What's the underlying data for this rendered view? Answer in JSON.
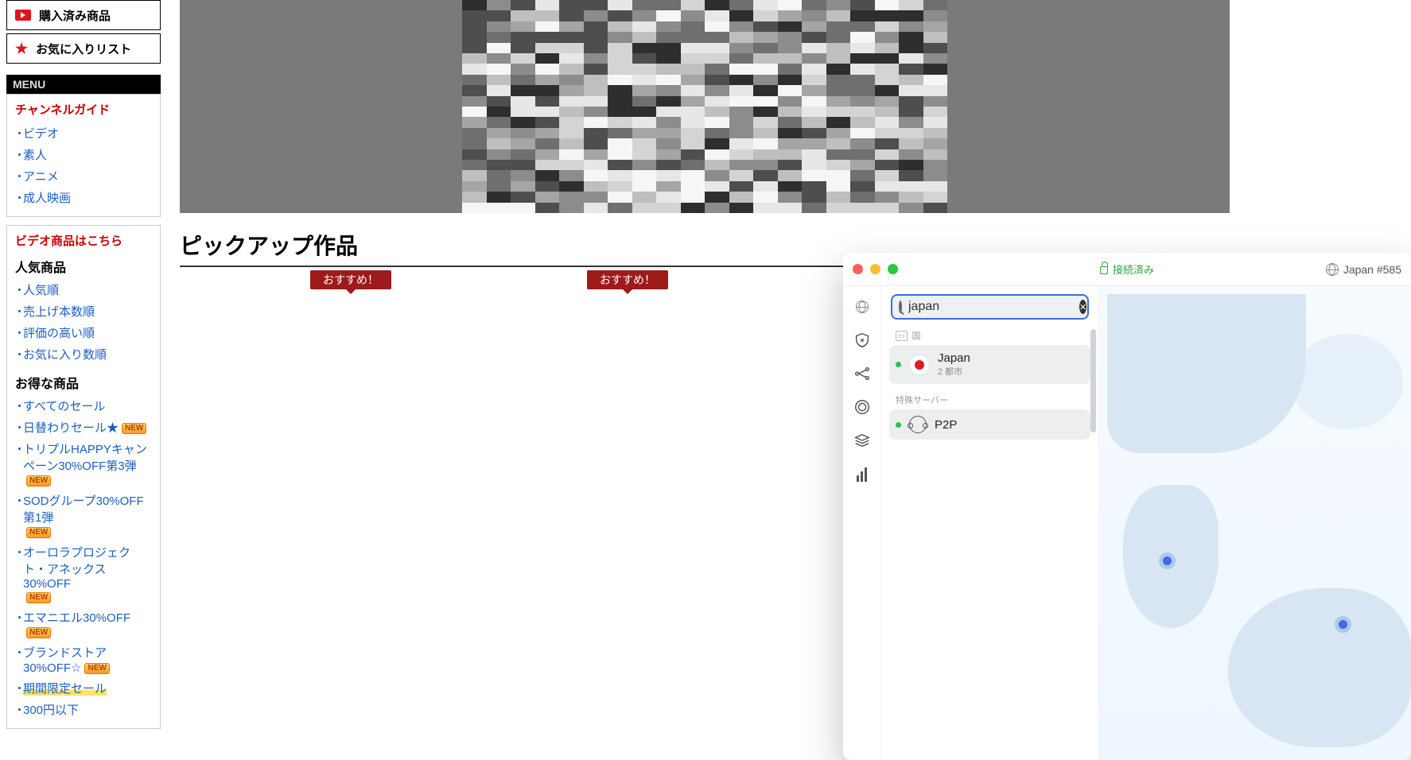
{
  "sidebar": {
    "top_buttons": [
      {
        "label": "購入済み商品"
      },
      {
        "label": "お気に入りリスト"
      }
    ],
    "menu_label": "MENU",
    "channel_guide_header": "チャンネルガイド",
    "channel_links": [
      "ビデオ",
      "素人",
      "アニメ",
      "成人映画"
    ],
    "video_products_header": "ビデオ商品はこちら",
    "popular_header": "人気商品",
    "popular_links": [
      "人気順",
      "売上げ本数順",
      "評価の高い順",
      "お気に入り数順"
    ],
    "deals_header": "お得な商品",
    "deals_links": [
      {
        "label": "すべてのセール",
        "new": false
      },
      {
        "label": "日替わりセール★",
        "new": true,
        "star": true
      },
      {
        "label": "トリプルHAPPYキャンペーン30%OFF第3弾",
        "new": true
      },
      {
        "label": "SODグループ30%OFF第1弾",
        "new": true
      },
      {
        "label": "オーロラプロジェクト・アネックス30%OFF",
        "new": true
      },
      {
        "label": "エマニエル30%OFF",
        "new": true
      },
      {
        "label": "ブランドストア30%OFF☆",
        "new": true
      },
      {
        "label": "期間限定セール",
        "new": false,
        "hl": true
      },
      {
        "label": "300円以下",
        "new": false
      }
    ]
  },
  "main": {
    "pickup_heading": "ピックアップ作品",
    "recommend_badge": "おすすめ！"
  },
  "app": {
    "status_text": "接続済み",
    "server_label": "Japan #585",
    "search_value": "japan",
    "section_country": "国",
    "japan_label": "Japan",
    "japan_sub": "2 都市",
    "section_special": "特殊サーバー",
    "p2p_label": "P2P"
  },
  "new_badge_text": "NEW"
}
